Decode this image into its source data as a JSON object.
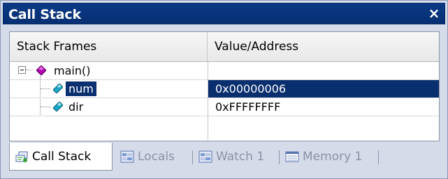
{
  "window": {
    "title": "Call Stack",
    "close_label": "×"
  },
  "columns": {
    "frames": "Stack Frames",
    "value": "Value/Address"
  },
  "rows": [
    {
      "name": "main()",
      "value": ""
    },
    {
      "name": "num",
      "value": "0x00000006"
    },
    {
      "name": "dir",
      "value": "0xFFFFFFFF"
    }
  ],
  "tabs": [
    {
      "label": "Call Stack",
      "icon": "call-stack-icon",
      "active": true
    },
    {
      "label": "Locals",
      "icon": "locals-icon",
      "active": false
    },
    {
      "label": "Watch 1",
      "icon": "watch-icon",
      "active": false
    },
    {
      "label": "Memory 1",
      "icon": "memory-icon",
      "active": false
    }
  ],
  "colors": {
    "title_bg": "#0a3a86",
    "selection_bg": "#0a2f6e",
    "function_icon": "#b000b0",
    "variable_icon": "#1aa8c8"
  }
}
